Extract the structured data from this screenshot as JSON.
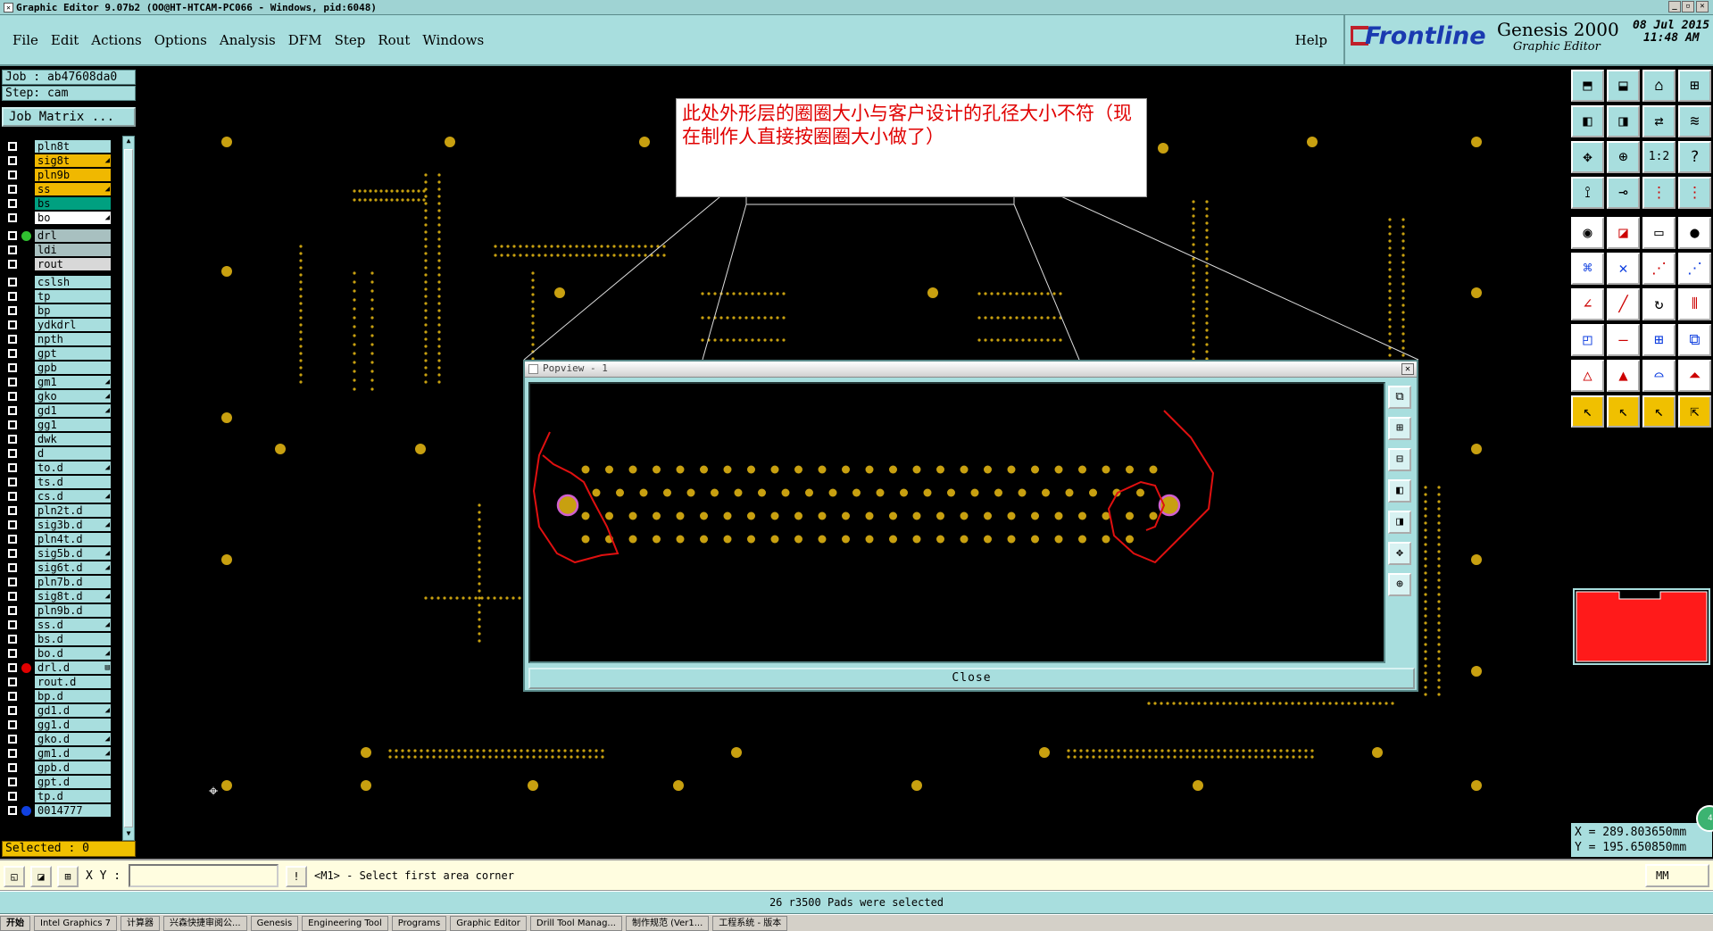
{
  "window": {
    "title": "Graphic Editor 9.07b2 (OO@HT-HTCAM-PC066 - Windows, pid:6048)"
  },
  "menu": {
    "items": [
      "File",
      "Edit",
      "Actions",
      "Options",
      "Analysis",
      "DFM",
      "Step",
      "Rout",
      "Windows"
    ],
    "help": "Help"
  },
  "logo": {
    "brand": "Frontline",
    "product": "Genesis 2000",
    "subtitle": "Graphic Editor",
    "date": "08 Jul 2015",
    "time": "11:48 AM"
  },
  "panel": {
    "job": "Job : ab47608da0",
    "step": "Step: cam",
    "job_matrix": "Job Matrix ...",
    "selected": "Selected : 0"
  },
  "layers": [
    {
      "name": "pln8t",
      "bg": "#a8dede",
      "dot": "",
      "arrow": ""
    },
    {
      "name": "sig8t",
      "bg": "#f0b800",
      "dot": "",
      "arrow": "◢"
    },
    {
      "name": "pln9b",
      "bg": "#f0b800",
      "dot": "",
      "arrow": ""
    },
    {
      "name": "ss",
      "bg": "#f0b800",
      "dot": "",
      "arrow": "◢"
    },
    {
      "name": "bs",
      "bg": "#00a080",
      "dot": "",
      "arrow": ""
    },
    {
      "name": "bo",
      "bg": "#ffffff",
      "dot": "",
      "arrow": "◢"
    },
    {
      "name": "drl",
      "bg": "#a8c0c0",
      "dot": "#30c030",
      "arrow": ""
    },
    {
      "name": "ldi",
      "bg": "#a8c0c0",
      "dot": "",
      "arrow": ""
    },
    {
      "name": "rout",
      "bg": "#d8d8d8",
      "dot": "",
      "arrow": ""
    },
    {
      "name": "cslsh",
      "bg": "#a8dede",
      "dot": "",
      "arrow": ""
    },
    {
      "name": "tp",
      "bg": "#a8dede",
      "dot": "",
      "arrow": ""
    },
    {
      "name": "bp",
      "bg": "#a8dede",
      "dot": "",
      "arrow": ""
    },
    {
      "name": "ydkdrl",
      "bg": "#a8dede",
      "dot": "",
      "arrow": ""
    },
    {
      "name": "npth",
      "bg": "#a8dede",
      "dot": "",
      "arrow": ""
    },
    {
      "name": "gpt",
      "bg": "#a8dede",
      "dot": "",
      "arrow": ""
    },
    {
      "name": "gpb",
      "bg": "#a8dede",
      "dot": "",
      "arrow": ""
    },
    {
      "name": "gm1",
      "bg": "#a8dede",
      "dot": "",
      "arrow": "◢"
    },
    {
      "name": "gko",
      "bg": "#a8dede",
      "dot": "",
      "arrow": "◢"
    },
    {
      "name": "gd1",
      "bg": "#a8dede",
      "dot": "",
      "arrow": "◢"
    },
    {
      "name": "gg1",
      "bg": "#a8dede",
      "dot": "",
      "arrow": ""
    },
    {
      "name": "dwk",
      "bg": "#a8dede",
      "dot": "",
      "arrow": ""
    },
    {
      "name": "d",
      "bg": "#a8dede",
      "dot": "",
      "arrow": ""
    },
    {
      "name": "to.d",
      "bg": "#a8dede",
      "dot": "",
      "arrow": "◢"
    },
    {
      "name": "ts.d",
      "bg": "#a8dede",
      "dot": "",
      "arrow": ""
    },
    {
      "name": "cs.d",
      "bg": "#a8dede",
      "dot": "",
      "arrow": "◢"
    },
    {
      "name": "pln2t.d",
      "bg": "#a8dede",
      "dot": "",
      "arrow": ""
    },
    {
      "name": "sig3b.d",
      "bg": "#a8dede",
      "dot": "",
      "arrow": "◢"
    },
    {
      "name": "pln4t.d",
      "bg": "#a8dede",
      "dot": "",
      "arrow": ""
    },
    {
      "name": "sig5b.d",
      "bg": "#a8dede",
      "dot": "",
      "arrow": "◢"
    },
    {
      "name": "sig6t.d",
      "bg": "#a8dede",
      "dot": "",
      "arrow": "◢"
    },
    {
      "name": "pln7b.d",
      "bg": "#a8dede",
      "dot": "",
      "arrow": ""
    },
    {
      "name": "sig8t.d",
      "bg": "#a8dede",
      "dot": "",
      "arrow": "◢"
    },
    {
      "name": "pln9b.d",
      "bg": "#a8dede",
      "dot": "",
      "arrow": ""
    },
    {
      "name": "ss.d",
      "bg": "#a8dede",
      "dot": "",
      "arrow": "◢"
    },
    {
      "name": "bs.d",
      "bg": "#a8dede",
      "dot": "",
      "arrow": ""
    },
    {
      "name": "bo.d",
      "bg": "#a8dede",
      "dot": "",
      "arrow": "◢"
    },
    {
      "name": "drl.d",
      "bg": "#a8dede",
      "dot": "#e00000",
      "arrow": "▤"
    },
    {
      "name": "rout.d",
      "bg": "#a8dede",
      "dot": "",
      "arrow": ""
    },
    {
      "name": "bp.d",
      "bg": "#a8dede",
      "dot": "",
      "arrow": ""
    },
    {
      "name": "gd1.d",
      "bg": "#a8dede",
      "dot": "",
      "arrow": "◢"
    },
    {
      "name": "gg1.d",
      "bg": "#a8dede",
      "dot": "",
      "arrow": ""
    },
    {
      "name": "gko.d",
      "bg": "#a8dede",
      "dot": "",
      "arrow": "◢"
    },
    {
      "name": "gm1.d",
      "bg": "#a8dede",
      "dot": "",
      "arrow": "◢"
    },
    {
      "name": "gpb.d",
      "bg": "#a8dede",
      "dot": "",
      "arrow": ""
    },
    {
      "name": "gpt.d",
      "bg": "#a8dede",
      "dot": "",
      "arrow": ""
    },
    {
      "name": "tp.d",
      "bg": "#a8dede",
      "dot": "",
      "arrow": ""
    },
    {
      "name": "0014777",
      "bg": "#a8dede",
      "dot": "#1040e0",
      "arrow": ""
    }
  ],
  "annotation": {
    "text": "此处外形层的圈圈大小与客户设计的孔径大小不符（现在制作人直接按圈圈大小做了）"
  },
  "popview": {
    "title": "Popview - 1",
    "close_label": "Close",
    "close_x": "✕"
  },
  "coords": {
    "x": "X = 289.803650mm",
    "y": "Y = 195.650850mm"
  },
  "command": {
    "xy_label": "X Y :",
    "input_value": "",
    "prompt": "<M1> - Select first area corner",
    "units": "MM"
  },
  "status": {
    "message": "26 r3500 Pads were selected"
  },
  "taskbar": {
    "items": [
      "开始",
      "Intel Graphics 7",
      "计算器",
      "兴森快捷审阅公...",
      "Genesis",
      "Engineering Tool",
      "Programs",
      "Graphic Editor",
      "Drill Tool Manag...",
      "制作规范 (Ver1...",
      "工程系统 - 版本"
    ]
  },
  "colors": {
    "accent": "#a8dede",
    "pad": "#c8a010",
    "annotation_red": "#e00000",
    "selected_yellow": "#f0c000"
  },
  "icons": {
    "close": "close-icon",
    "cursor": "crosshair-icon"
  }
}
